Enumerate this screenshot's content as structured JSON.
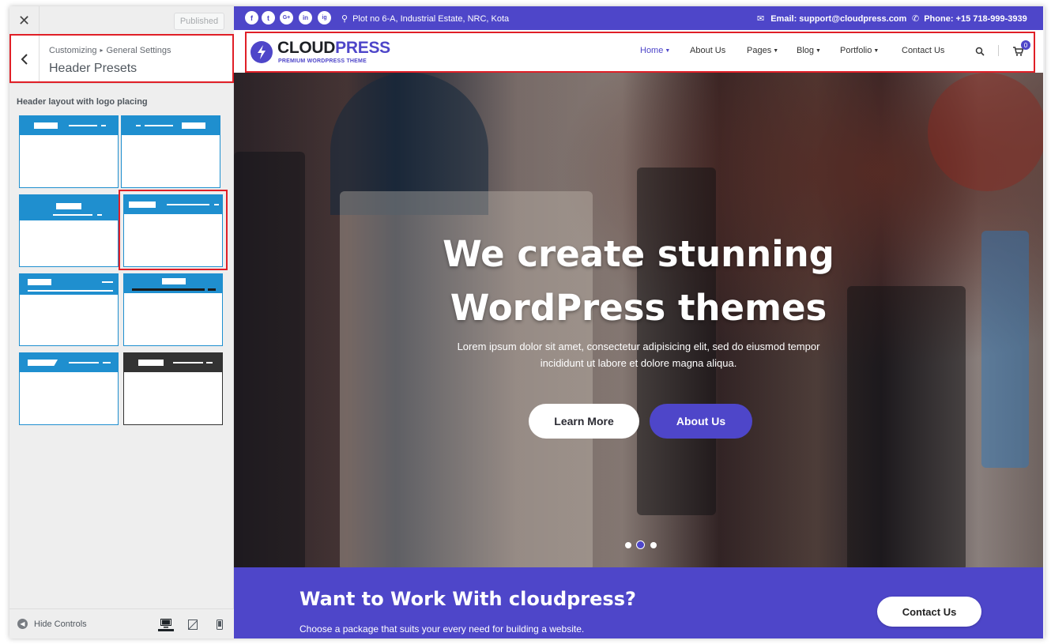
{
  "customizer": {
    "close_icon": "close-icon",
    "publish_label": "Published",
    "breadcrumb": {
      "root": "Customizing",
      "parent": "General Settings"
    },
    "section_title": "Header Presets",
    "presets_label": "Header layout with logo placing",
    "selected_preset_index": 4,
    "presets": [
      {
        "id": "preset-1",
        "style": "logo-left-menu-right"
      },
      {
        "id": "preset-2",
        "style": "menu-left-logo-right"
      },
      {
        "id": "preset-3",
        "style": "logo-center-menu-below"
      },
      {
        "id": "preset-4",
        "style": "logo-left-menu-right-inline"
      },
      {
        "id": "preset-5",
        "style": "logo-left-menu-below"
      },
      {
        "id": "preset-6",
        "style": "logo-center-menu-bar"
      },
      {
        "id": "preset-7",
        "style": "slanted-logo-menu-right"
      },
      {
        "id": "preset-8",
        "style": "dark-logo-menu-right"
      }
    ],
    "footer": {
      "hide_controls_label": "Hide Controls",
      "devices": [
        "desktop",
        "tablet",
        "mobile"
      ],
      "active_device": "desktop"
    }
  },
  "preview": {
    "topbar": {
      "social": [
        "f",
        "t",
        "G+",
        "in",
        "ig"
      ],
      "address": "Plot no 6-A, Industrial Estate, NRC, Kota",
      "email": "Email: support@cloudpress.com",
      "phone": "Phone: +15 718-999-3939"
    },
    "logo": {
      "part1": "CLOUD",
      "part2": "PRESS",
      "tagline": "PREMIUM WORDPRESS THEME"
    },
    "nav": [
      {
        "label": "Home",
        "dropdown": true,
        "active": true
      },
      {
        "label": "About Us",
        "dropdown": false,
        "active": false
      },
      {
        "label": "Pages",
        "dropdown": true,
        "active": false
      },
      {
        "label": "Blog",
        "dropdown": true,
        "active": false
      },
      {
        "label": "Portfolio",
        "dropdown": true,
        "active": false
      },
      {
        "label": "Contact Us",
        "dropdown": false,
        "active": false
      }
    ],
    "cart_count": "0",
    "hero": {
      "title_line1": "We create stunning",
      "title_line2": "WordPress themes",
      "subtitle": "Lorem ipsum dolor sit amet, consectetur adipisicing elit, sed do eiusmod tempor incididunt ut labore et dolore magna aliqua.",
      "primary_button": "Learn More",
      "secondary_button": "About Us",
      "slides": 3,
      "active_slide": 2
    },
    "cta": {
      "title": "Want to Work With cloudpress?",
      "subtitle": "Choose a package that suits your every need for building a website.",
      "button": "Contact Us"
    }
  },
  "colors": {
    "brand": "#4e46c9",
    "preset_blue": "#1f8fcf",
    "highlight_red": "#e01f27"
  }
}
